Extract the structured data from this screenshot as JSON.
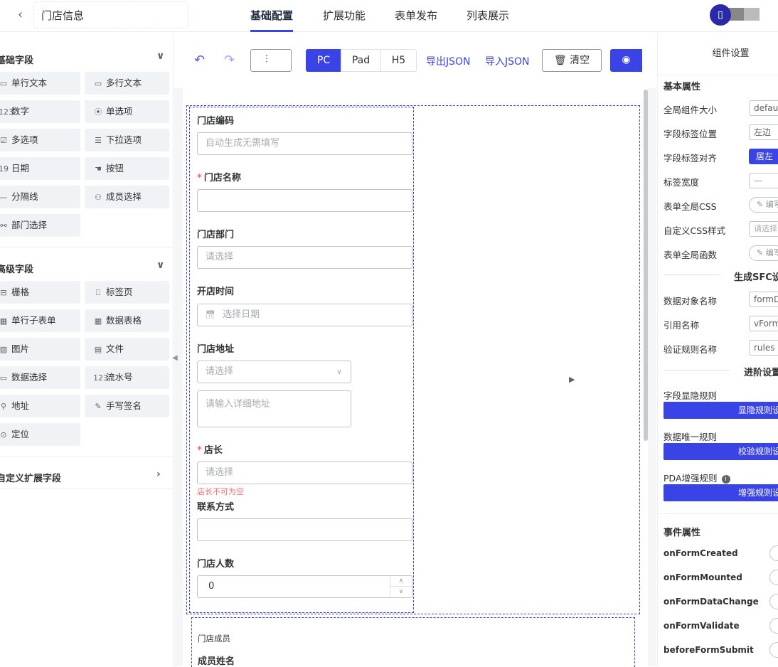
{
  "header": {
    "title": "门店信息",
    "tabs": [
      "基础配置",
      "扩展功能",
      "表单发布",
      "列表展示"
    ],
    "avatar_char": "▯"
  },
  "left": {
    "basic_title": "基础字段",
    "basic_items": [
      {
        "icon": "▭",
        "label": "单行文本"
      },
      {
        "icon": "▭",
        "label": "多行文本"
      },
      {
        "icon": "123",
        "label": "数字"
      },
      {
        "icon": "⦿",
        "label": "单选项"
      },
      {
        "icon": "☑",
        "label": "多选项"
      },
      {
        "icon": "☰",
        "label": "下拉选项"
      },
      {
        "icon": "19",
        "label": "日期"
      },
      {
        "icon": "☚",
        "label": "按钮"
      },
      {
        "icon": "—",
        "label": "分隔线"
      },
      {
        "icon": "⚇",
        "label": "成员选择"
      },
      {
        "icon": "⚯",
        "label": "部门选择"
      }
    ],
    "advanced_title": "高级字段",
    "advanced_items": [
      {
        "icon": "⊟",
        "label": "栅格"
      },
      {
        "icon": "⎕",
        "label": "标签页"
      },
      {
        "icon": "▦",
        "label": "单行子表单"
      },
      {
        "icon": "▦",
        "label": "数据表格"
      },
      {
        "icon": "▨",
        "label": "图片"
      },
      {
        "icon": "▤",
        "label": "文件"
      },
      {
        "icon": "▭",
        "label": "数据选择"
      },
      {
        "icon": "123",
        "label": "流水号"
      },
      {
        "icon": "⚲",
        "label": "地址"
      },
      {
        "icon": "✎",
        "label": "手写签名"
      },
      {
        "icon": "⊙",
        "label": "定位"
      }
    ],
    "custom_title": "自定义扩展字段"
  },
  "toolbar": {
    "undo": "↶",
    "redo": "↷",
    "tree": "⫶",
    "devices": [
      "PC",
      "Pad",
      "H5"
    ],
    "export_json": "导出JSON",
    "import_json": "导入JSON",
    "clear": "清空",
    "preview_icon": "◉"
  },
  "form": {
    "store_code_label": "门店编码",
    "store_code_placeholder": "自动生成无需填写",
    "store_name_label": "门店名称",
    "store_dept_label": "门店部门",
    "store_dept_placeholder": "请选择",
    "open_time_label": "开店时间",
    "open_time_placeholder": "选择日期",
    "address_label": "门店地址",
    "address_select_placeholder": "请选择",
    "address_detail_placeholder": "请输入详细地址",
    "manager_label": "店长",
    "manager_placeholder": "请选择",
    "manager_error": "店长不可为空",
    "contact_label": "联系方式",
    "headcount_label": "门店人数",
    "headcount_value": "0",
    "members_title": "门店成员",
    "member_name_label": "成员姓名"
  },
  "right": {
    "title": "组件设置",
    "basic_title": "基本属性",
    "props": [
      {
        "label": "全局组件大小",
        "value": "default"
      },
      {
        "label": "字段标签位置",
        "value": "左边"
      },
      {
        "label": "字段标签对齐",
        "value": "居左"
      },
      {
        "label": "标签宽度",
        "value": "—"
      },
      {
        "label": "表单全局CSS",
        "value": "编写"
      },
      {
        "label": "自定义CSS样式",
        "value": "请选择"
      },
      {
        "label": "表单全局函数",
        "value": "编写"
      }
    ],
    "sfc_title": "生成SFC设置",
    "sfc_props": [
      {
        "label": "数据对象名称",
        "value": "formData"
      },
      {
        "label": "引用名称",
        "value": "vForm"
      },
      {
        "label": "验证规则名称",
        "value": "rules"
      }
    ],
    "advanced_title": "进阶设置",
    "rules": [
      {
        "label": "字段显隐规则",
        "button": "显隐规则设置"
      },
      {
        "label": "数据唯一规则",
        "button": "校验规则设置"
      },
      {
        "label": "PDA增强规则",
        "button": "增强规则设置"
      }
    ],
    "events_title": "事件属性",
    "events": [
      "onFormCreated",
      "onFormMounted",
      "onFormDataChange",
      "onFormValidate",
      "beforeFormSubmit"
    ]
  }
}
